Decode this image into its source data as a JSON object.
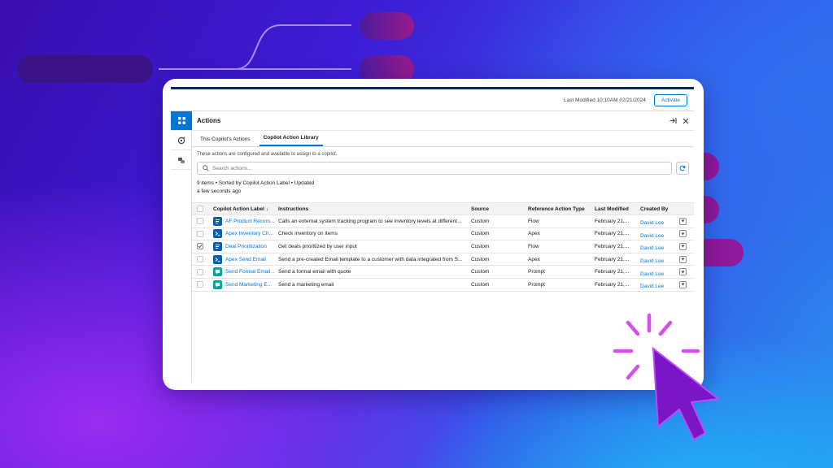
{
  "header": {
    "last_modified": "Last Modified 10:10AM 02/21/2024",
    "activate_label": "Activate"
  },
  "rail": {
    "items": [
      {
        "icon": "grid-icon",
        "active": true
      },
      {
        "icon": "copilot-icon",
        "active": false
      },
      {
        "icon": "tools-icon",
        "active": false
      }
    ]
  },
  "panel": {
    "title": "Actions",
    "tabs": [
      "This Copilot's Actions",
      "Copilot Action Library"
    ],
    "active_tab": 1,
    "description": "These actions are configured and available to assign to a copilot.",
    "search_placeholder": "Search actions...",
    "meta_line1": "9 items • Sorted by Copilot Action Label • Updated",
    "meta_line2": "a few seconds ago"
  },
  "table": {
    "columns": [
      "Copilot Action Label ↓",
      "Instructions",
      "Source",
      "Reference Action Type",
      "Last Modified",
      "Created By"
    ],
    "rows": [
      {
        "label": "AF Product Recom...",
        "icon": "flow-icon",
        "icon_color": "#0b5cab",
        "instructions": "Calls an external system tracking program to see inventory levels at different...",
        "source": "Custom",
        "ref_type": "Flow",
        "modified": "February 21,...",
        "created_by": "David Lee",
        "checked": false
      },
      {
        "label": "Apex Inventory Ch...",
        "icon": "apex-icon",
        "icon_color": "#0b5cab",
        "instructions": "Check inventory on items",
        "source": "Custom",
        "ref_type": "Apex",
        "modified": "February 21,...",
        "created_by": "David Lee",
        "checked": false
      },
      {
        "label": "Deal Prioritization",
        "icon": "flow-icon",
        "icon_color": "#0b5cab",
        "instructions": "Get deals prioritized by user input",
        "source": "Custom",
        "ref_type": "Flow",
        "modified": "February 21,...",
        "created_by": "David Lee",
        "checked": true
      },
      {
        "label": "Apex Send Email",
        "icon": "apex-icon",
        "icon_color": "#0b5cab",
        "instructions": "Send a pre-created Email template to a customer with data integrated from S...",
        "source": "Custom",
        "ref_type": "Apex",
        "modified": "February 21,...",
        "created_by": "David Lee",
        "checked": false
      },
      {
        "label": "Send Formal Email...",
        "icon": "prompt-icon",
        "icon_color": "#06a59a",
        "instructions": "Send a formal email with quote",
        "source": "Custom",
        "ref_type": "Prompt",
        "modified": "February 21,...",
        "created_by": "David Lee",
        "checked": false
      },
      {
        "label": "Send Marketing E...",
        "icon": "prompt-icon",
        "icon_color": "#06a59a",
        "instructions": "Send a marketing email",
        "source": "Custom",
        "ref_type": "Prompt",
        "modified": "February 21,...",
        "created_by": "David Lee",
        "checked": false
      }
    ]
  },
  "colors": {
    "brand": "#0176d3",
    "navy": "#032d60",
    "pill_dark": "#3b1496",
    "pill_magenta": "#a51890",
    "spark": "#d84cf0"
  }
}
